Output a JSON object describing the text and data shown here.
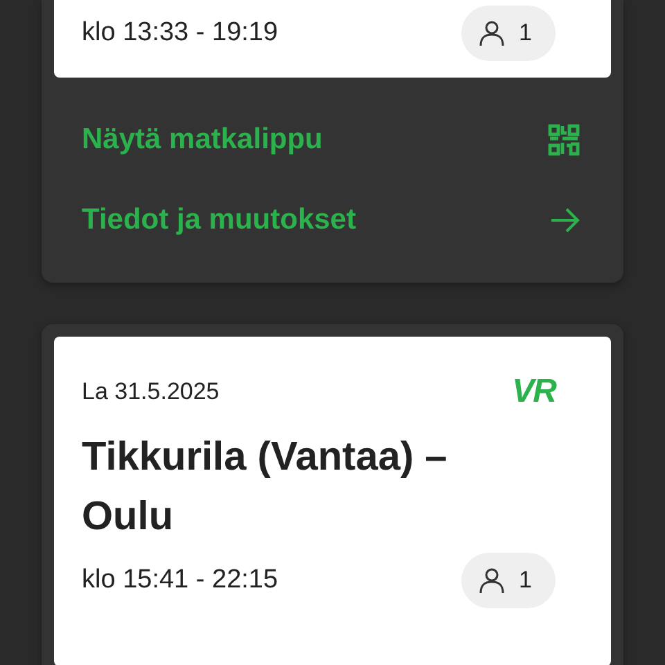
{
  "trips": [
    {
      "time": "klo 13:33 - 19:19",
      "passengers": "1",
      "actions": [
        {
          "label": "Näytä matkalippu",
          "kind": "qr"
        },
        {
          "label": "Tiedot ja muutokset",
          "kind": "arrow"
        }
      ]
    },
    {
      "date": "La 31.5.2025",
      "logo": "VR",
      "route": "Tikkurila (Vantaa) – Oulu",
      "time": "klo 15:41 - 22:15",
      "passengers": "1"
    }
  ]
}
